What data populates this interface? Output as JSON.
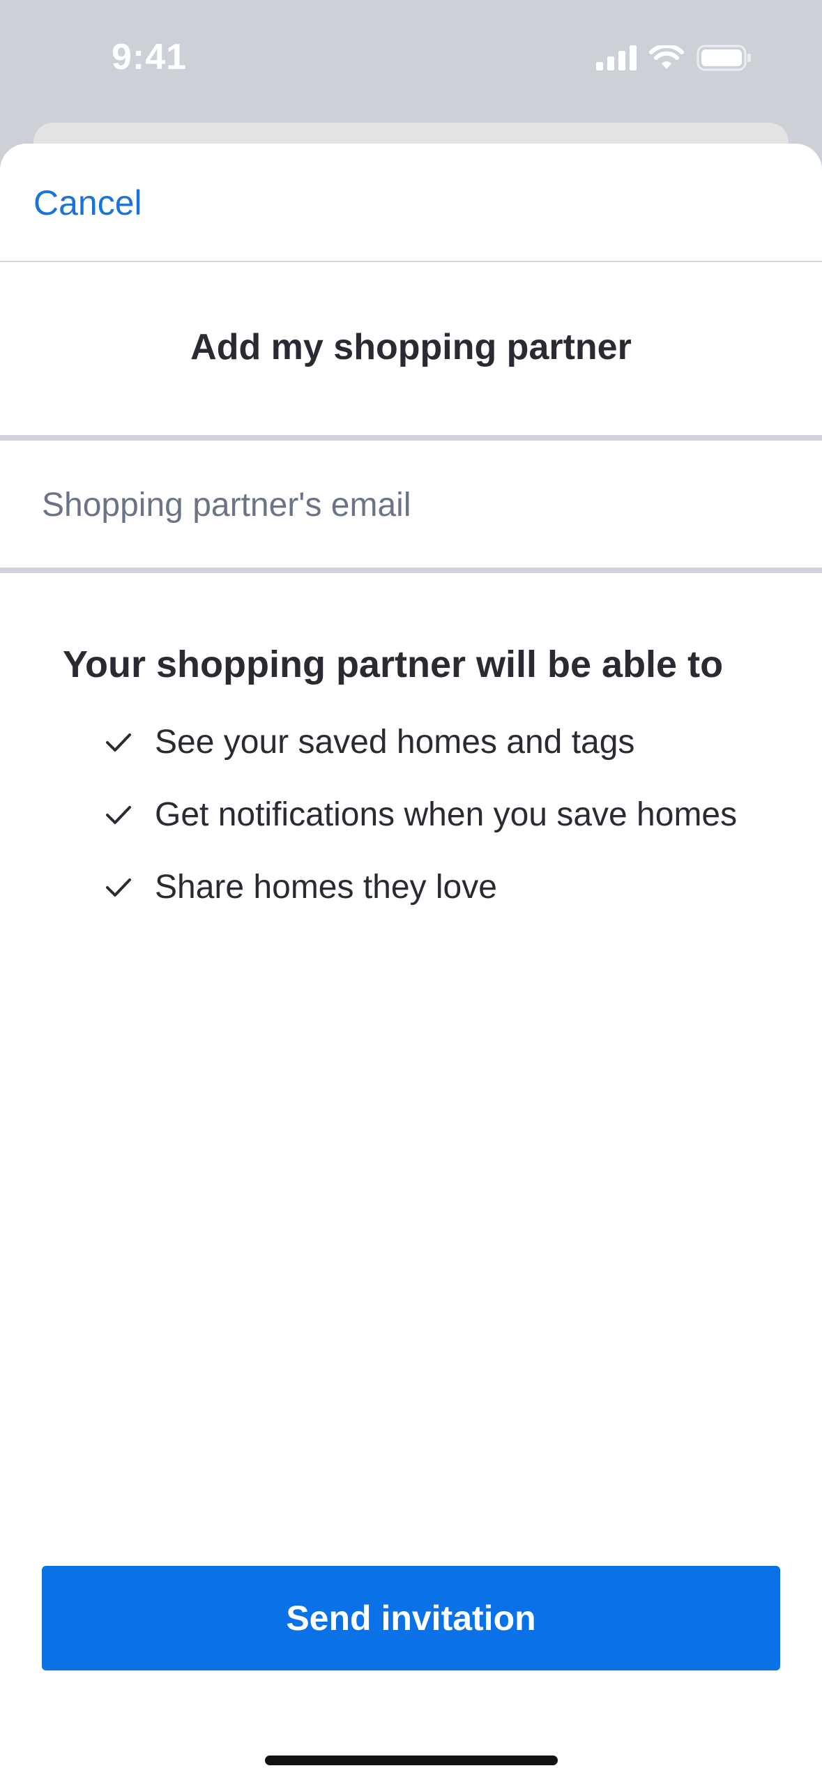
{
  "status_bar": {
    "time": "9:41",
    "icons": [
      "cellular-signal-icon",
      "wifi-icon",
      "battery-icon"
    ]
  },
  "nav": {
    "cancel_label": "Cancel"
  },
  "page": {
    "title": "Add my shopping partner"
  },
  "email": {
    "placeholder": "Shopping partner's email",
    "value": ""
  },
  "benefits": {
    "heading": "Your shopping partner will be able to",
    "items": [
      {
        "icon": "checkmark-icon",
        "label": "See your saved homes and tags"
      },
      {
        "icon": "checkmark-icon",
        "label": "Get notifications when you save homes"
      },
      {
        "icon": "checkmark-icon",
        "label": "Share homes they love"
      }
    ]
  },
  "actions": {
    "send_label": "Send invitation"
  },
  "colors": {
    "accent": "#0a72e6",
    "link": "#1a73d9",
    "text": "#2a2a33",
    "placeholder": "#6b7386",
    "backdrop": "#ccd1d7"
  }
}
